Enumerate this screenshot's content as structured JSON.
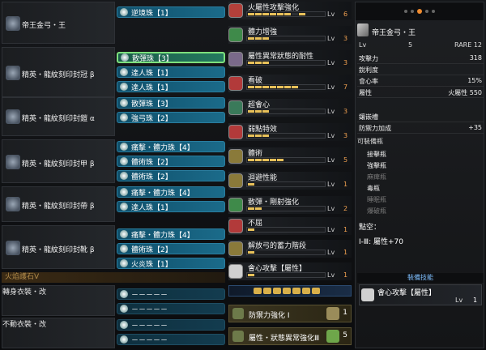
{
  "left": {
    "equipment": [
      {
        "name": "帝王金弓・王",
        "decos": [
          "逆境珠【1】"
        ]
      },
      {
        "name": "精英・龍紋刻印封冠 β",
        "decos": [
          "散彈珠【3】",
          "達人珠【1】",
          "達人珠【1】"
        ]
      },
      {
        "name": "精英・龍紋刻印封鎧 α",
        "decos": [
          "散彈珠【3】",
          "強弓珠【2】"
        ]
      },
      {
        "name": "精英・龍紋刻印封甲 β",
        "decos": [
          "痛擊・體力珠【4】",
          "體術珠【2】",
          "體術珠【2】"
        ]
      },
      {
        "name": "精英・龍紋刻印封帶 β",
        "decos": [
          "痛擊・體力珠【4】",
          "達人珠【1】"
        ]
      },
      {
        "name": "精英・龍紋刻印封靴 β",
        "decos": [
          "痛擊・體力珠【4】",
          "體術珠【2】",
          "火炎珠【1】"
        ]
      }
    ],
    "charm": "火焰護石Ⅴ",
    "mantles": [
      {
        "name": "轉身衣裝・改",
        "decos": [
          "－－－－－",
          "－－－－－"
        ]
      },
      {
        "name": "不動衣裝・改",
        "decos": [
          "－－－－－",
          "－－－－－"
        ]
      }
    ]
  },
  "skills": [
    {
      "name": "火屬性攻擊強化",
      "lv": "Lv",
      "num": "6"
    },
    {
      "name": "體力增強",
      "lv": "Lv",
      "num": "3"
    },
    {
      "name": "屬性異常狀態的耐性",
      "lv": "Lv",
      "num": "3"
    },
    {
      "name": "看破",
      "lv": "Lv",
      "num": "7"
    },
    {
      "name": "超會心",
      "lv": "Lv",
      "num": "3"
    },
    {
      "name": "弱點特效",
      "lv": "Lv",
      "num": "3"
    },
    {
      "name": "體術",
      "lv": "Lv",
      "num": "5"
    },
    {
      "name": "迴避性能",
      "lv": "Lv",
      "num": "1"
    },
    {
      "name": "散彈・剛射強化",
      "lv": "Lv",
      "num": "2"
    },
    {
      "name": "不屈",
      "lv": "Lv",
      "num": "1"
    },
    {
      "name": "解放弓的蓄力階段",
      "lv": "Lv",
      "num": "1"
    },
    {
      "name": "會心攻擊【屬性】",
      "lv": "Lv",
      "num": "1"
    }
  ],
  "set_bonuses": [
    {
      "name": "防禦力強化 Ⅰ",
      "count": "1"
    },
    {
      "name": "屬性・狀態異常強化Ⅲ",
      "count": "5"
    }
  ],
  "detail": {
    "weapon_name": "帝王金弓・王",
    "lv_label": "Lv",
    "lv_value": "5",
    "rarity": "RARE 12",
    "stats": [
      {
        "k": "攻擊力",
        "v": "318"
      },
      {
        "k": "銳利度",
        "v": ""
      },
      {
        "k": "會心率",
        "v": "15%"
      },
      {
        "k": "屬性",
        "v": "火屬性 550"
      },
      {
        "k": "鑲嵌槽",
        "v": ""
      },
      {
        "k": "防禦力加成",
        "v": "+35"
      }
    ],
    "ammo_title": "可裝備瓶",
    "ammo": [
      "接擊瓶",
      "強擊瓶",
      "麻痺瓶",
      "毒瓶",
      "睡眠瓶",
      "爆破瓶"
    ],
    "notes_title": "點空：",
    "notes": "Ⅰ-Ⅲ: 屬性+70",
    "equip_skill_title": "裝備技能",
    "equip_skill": {
      "name": "會心攻擊【屬性】",
      "lv": "Lv",
      "num": "1"
    }
  }
}
